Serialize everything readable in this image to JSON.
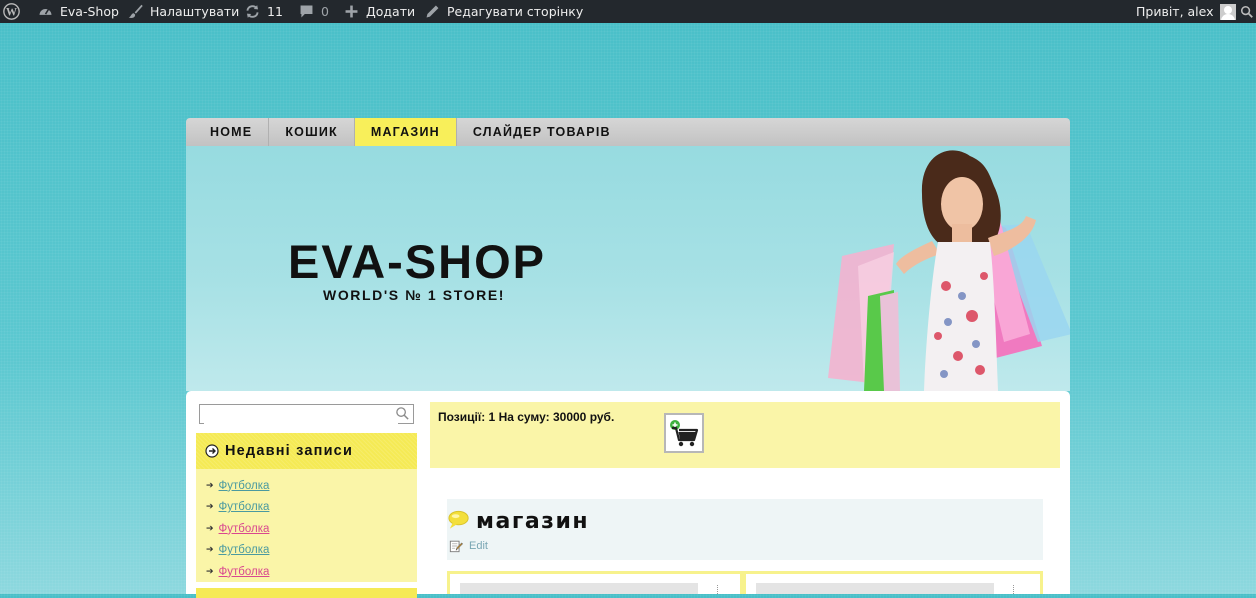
{
  "adminbar": {
    "site_name": "Eva-Shop",
    "customize": "Налаштувати",
    "updates": "11",
    "comments": "0",
    "add_new": "Додати",
    "edit_page": "Редагувати сторінку",
    "greeting": "Привіт, alex"
  },
  "nav": {
    "items": [
      {
        "label": "HOME"
      },
      {
        "label": "КОШИК"
      },
      {
        "label": "МАГАЗИН",
        "active": true
      },
      {
        "label": "СЛАЙДЕР ТОВАРІВ"
      }
    ]
  },
  "header": {
    "title": "EVA-SHOP",
    "tagline": "WORLD'S № 1 STORE!"
  },
  "sidebar": {
    "search": {
      "value": "",
      "placeholder": ""
    },
    "recent": {
      "title": "Недавні записи",
      "items": [
        {
          "label": "Футболка",
          "color": "#4b9aa0"
        },
        {
          "label": "Футболка",
          "color": "#4b9aa0"
        },
        {
          "label": "Футболка",
          "color": "#d9488f"
        },
        {
          "label": "Футболка",
          "color": "#4b9aa0"
        },
        {
          "label": "Футболка",
          "color": "#d9488f"
        }
      ]
    }
  },
  "cart": {
    "summary": "Позиції: 1   На суму: 30000 руб."
  },
  "page": {
    "title": "магазин",
    "edit_label": "Edit"
  },
  "colors": {
    "accent_yellow": "#f8ef5a",
    "panel_yellow": "#faf5a8",
    "adminbar": "#23282d",
    "link_teal": "#4b9aa0",
    "link_pink": "#d9488f"
  }
}
